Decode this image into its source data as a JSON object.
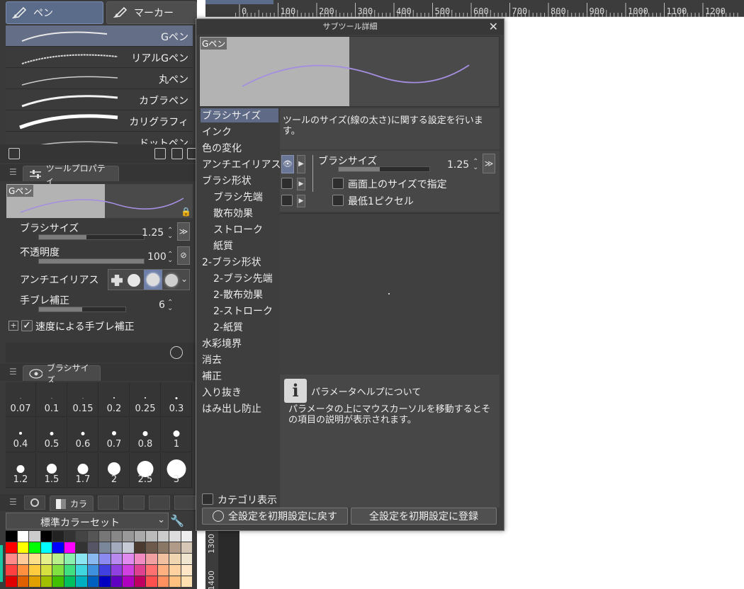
{
  "tool_tabs": {
    "pen": "ペン",
    "marker": "マーカー"
  },
  "subtools": [
    {
      "label": "Gペン",
      "selected": true
    },
    {
      "label": "リアルGペン",
      "selected": false
    },
    {
      "label": "丸ペン",
      "selected": false
    },
    {
      "label": "カブラペン",
      "selected": false
    },
    {
      "label": "カリグラフィ",
      "selected": false
    },
    {
      "label": "ドットペン",
      "selected": false
    }
  ],
  "tool_property": {
    "tab_label": "ツールプロパティ",
    "preview_label": "Gペン",
    "brush_size_label": "ブラシサイズ",
    "brush_size_value": "1.25",
    "brush_size_fill": 0.45,
    "opacity_label": "不透明度",
    "opacity_value": "100",
    "opacity_fill": 1.0,
    "antialias_label": "アンチエイリアス",
    "stabilization_label": "手ブレ補正",
    "stabilization_value": "6",
    "stabilization_fill": 0.5,
    "speed_stab_label": "速度による手ブレ補正",
    "speed_stab_checked": true
  },
  "brush_size_palette": {
    "tab_label": "ブラシサイズ",
    "sizes": [
      "0.07",
      "0.1",
      "0.15",
      "0.2",
      "0.25",
      "0.3",
      "0.4",
      "0.5",
      "0.6",
      "0.7",
      "0.8",
      "1",
      "1.2",
      "1.5",
      "1.7",
      "2",
      "2.5",
      "3"
    ]
  },
  "color_set": {
    "tab_label": "カラ",
    "select_value": "標準カラーセット"
  },
  "ruler": {
    "top_numbers": [
      "0",
      "100",
      "200",
      "300",
      "400",
      "500",
      "600",
      "700",
      "800",
      "900",
      "1000",
      "1100",
      "1200"
    ],
    "left_numbers": [
      "1300",
      "1400"
    ]
  },
  "dialog": {
    "title": "サブツール詳細",
    "preview_label": "Gペン",
    "categories": [
      "ブラシサイズ",
      "インク",
      "色の変化",
      "アンチエイリアス",
      "ブラシ形状",
      "ブラシ先端",
      "散布効果",
      "ストローク",
      "紙質",
      "2-ブラシ形状",
      "2-ブラシ先端",
      "2-散布効果",
      "2-ストローク",
      "2-紙質",
      "水彩境界",
      "消去",
      "補正",
      "入り抜き",
      "はみ出し防止"
    ],
    "category_indent": [
      false,
      false,
      false,
      false,
      false,
      true,
      true,
      true,
      true,
      false,
      true,
      true,
      true,
      true,
      false,
      false,
      false,
      false,
      false
    ],
    "description": "ツールのサイズ(線の太さ)に関する設定を行います。",
    "param_brush_size_label": "ブラシサイズ",
    "param_brush_size_value": "1.25",
    "param_screen_size_label": "画面上のサイズで指定",
    "param_min_pixel_label": "最低1ピクセル",
    "help_title": "パラメータヘルプについて",
    "help_text": "パラメータの上にマウスカーソルを移動するとその項目の説明が表示されます。",
    "category_display_label": "カテゴリ表示",
    "reset_button": "全設定を初期設定に戻す",
    "register_button": "全設定を初期設定に登録"
  },
  "colors": {
    "accent": "#5e6a86",
    "stroke_purple": "#a58ee0",
    "panel_bg": "#3a3a3a"
  }
}
